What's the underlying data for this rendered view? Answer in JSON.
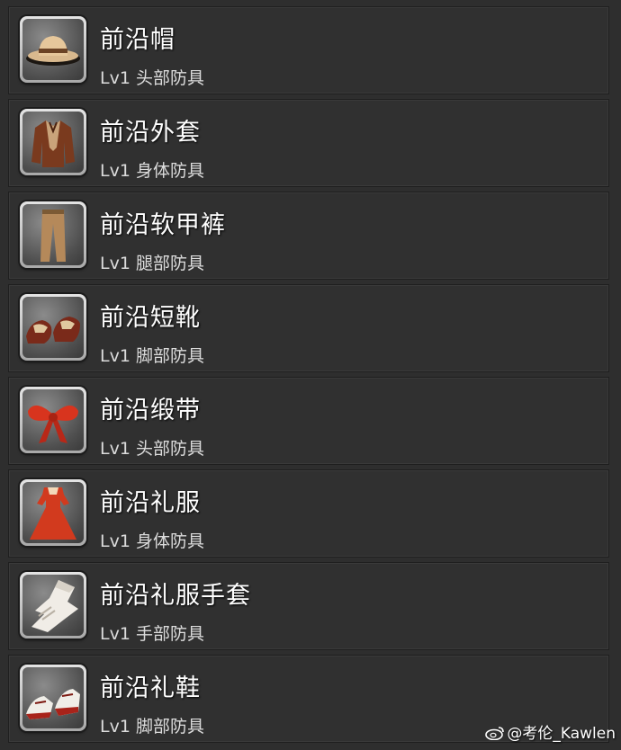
{
  "items": [
    {
      "name": "前沿帽",
      "level": "Lv1",
      "slot": "头部防具",
      "icon": "hat-icon"
    },
    {
      "name": "前沿外套",
      "level": "Lv1",
      "slot": "身体防具",
      "icon": "jacket-icon"
    },
    {
      "name": "前沿软甲裤",
      "level": "Lv1",
      "slot": "腿部防具",
      "icon": "pants-icon"
    },
    {
      "name": "前沿短靴",
      "level": "Lv1",
      "slot": "脚部防具",
      "icon": "shoes-icon"
    },
    {
      "name": "前沿缎带",
      "level": "Lv1",
      "slot": "头部防具",
      "icon": "ribbon-icon"
    },
    {
      "name": "前沿礼服",
      "level": "Lv1",
      "slot": "身体防具",
      "icon": "dress-icon"
    },
    {
      "name": "前沿礼服手套",
      "level": "Lv1",
      "slot": "手部防具",
      "icon": "gloves-icon"
    },
    {
      "name": "前沿礼鞋",
      "level": "Lv1",
      "slot": "脚部防具",
      "icon": "heels-icon"
    }
  ],
  "watermark": {
    "text": "@考伦_Kawlen",
    "icon": "weibo-icon"
  }
}
